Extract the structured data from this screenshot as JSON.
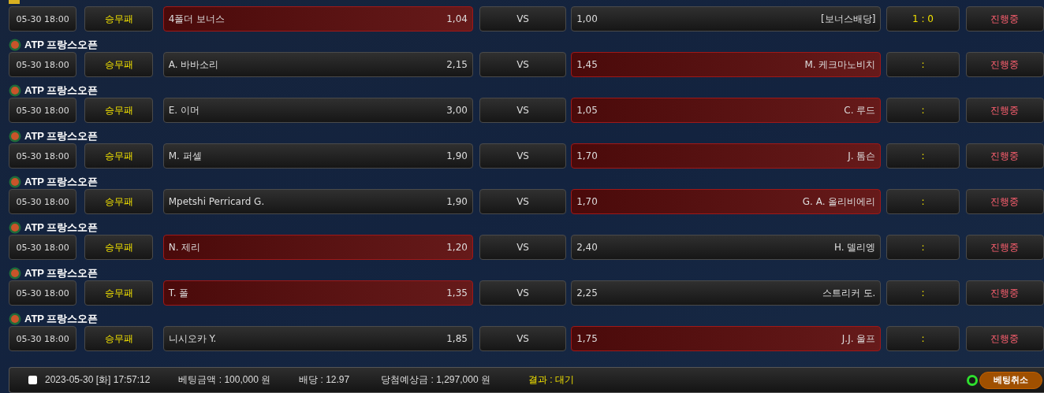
{
  "matches": [
    {
      "time": "05-30 18:00",
      "market": "승무패",
      "home": {
        "name": "4폴더 보너스",
        "odds": "1,04",
        "selected": true
      },
      "vs": "VS",
      "away": {
        "name": "[보너스배당]",
        "odds": "1,00",
        "selected": false
      },
      "score": "1 : 0",
      "status": "진행중"
    },
    {
      "league": "ATP 프랑스오픈",
      "time": "05-30 18:00",
      "market": "승무패",
      "home": {
        "name": "A. 바바소리",
        "odds": "2,15",
        "selected": false
      },
      "vs": "VS",
      "away": {
        "name": "M. 케크마노비치",
        "odds": "1,45",
        "selected": true
      },
      "score": ":",
      "status": "진행중"
    },
    {
      "league": "ATP 프랑스오픈",
      "time": "05-30 18:00",
      "market": "승무패",
      "home": {
        "name": "E. 이머",
        "odds": "3,00",
        "selected": false
      },
      "vs": "VS",
      "away": {
        "name": "C. 루드",
        "odds": "1,05",
        "selected": true
      },
      "score": ":",
      "status": "진행중"
    },
    {
      "league": "ATP 프랑스오픈",
      "time": "05-30 18:00",
      "market": "승무패",
      "home": {
        "name": "M. 퍼셀",
        "odds": "1,90",
        "selected": false
      },
      "vs": "VS",
      "away": {
        "name": "J. 톰슨",
        "odds": "1,70",
        "selected": true
      },
      "score": ":",
      "status": "진행중"
    },
    {
      "league": "ATP 프랑스오픈",
      "time": "05-30 18:00",
      "market": "승무패",
      "home": {
        "name": "Mpetshi Perricard G.",
        "odds": "1,90",
        "selected": false
      },
      "vs": "VS",
      "away": {
        "name": "G. A. 올리비에리",
        "odds": "1,70",
        "selected": true
      },
      "score": ":",
      "status": "진행중"
    },
    {
      "league": "ATP 프랑스오픈",
      "time": "05-30 18:00",
      "market": "승무패",
      "home": {
        "name": "N. 제리",
        "odds": "1,20",
        "selected": true
      },
      "vs": "VS",
      "away": {
        "name": "H. 델리엥",
        "odds": "2,40",
        "selected": false
      },
      "score": ":",
      "status": "진행중"
    },
    {
      "league": "ATP 프랑스오픈",
      "time": "05-30 18:00",
      "market": "승무패",
      "home": {
        "name": "T. 폴",
        "odds": "1,35",
        "selected": true
      },
      "vs": "VS",
      "away": {
        "name": "스트리커 도.",
        "odds": "2,25",
        "selected": false
      },
      "score": ":",
      "status": "진행중"
    },
    {
      "league": "ATP 프랑스오픈",
      "time": "05-30 18:00",
      "market": "승무패",
      "home": {
        "name": "니시오카 Y.",
        "odds": "1,85",
        "selected": false
      },
      "vs": "VS",
      "away": {
        "name": "J.J. 울프",
        "odds": "1,75",
        "selected": true
      },
      "score": ":",
      "status": "진행중"
    }
  ],
  "footer": {
    "checked": false,
    "datetime": "2023-05-30 [화] 17:57:12",
    "amount": "베팅금액 : 100,000 원",
    "odds": "배당 : 12.97",
    "expected": "당첨예상금 : 1,297,000 원",
    "result": "결과 : 대기",
    "cancel": "베팅취소"
  }
}
